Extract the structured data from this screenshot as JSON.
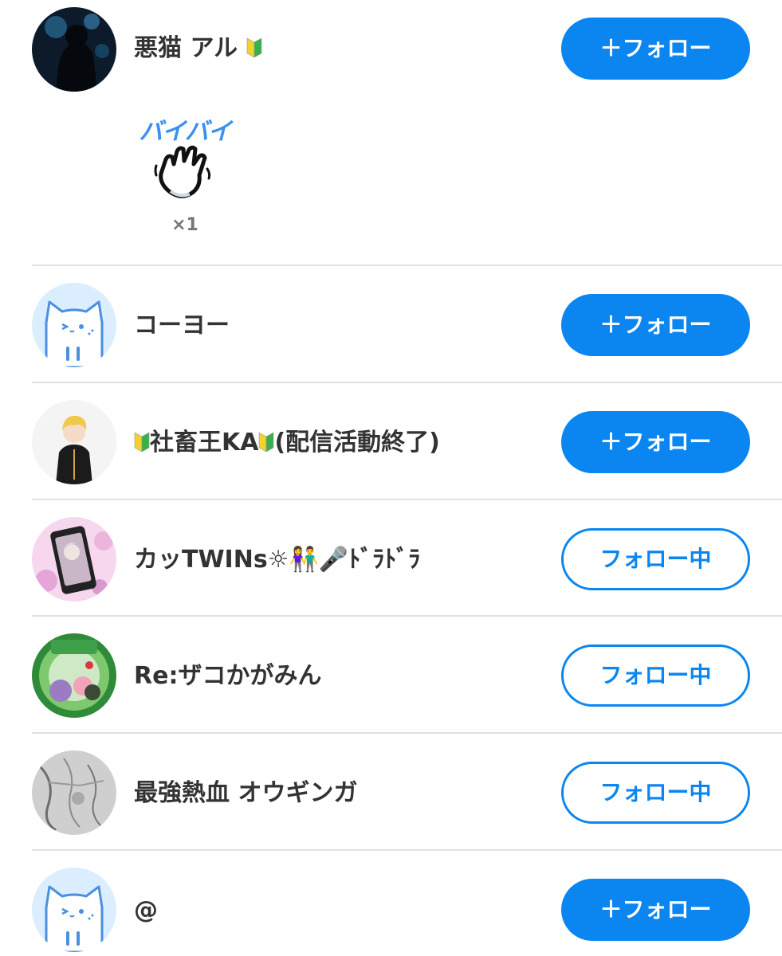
{
  "users": [
    {
      "name": "悪猫 アル",
      "badge": "beginner-mark",
      "button": "＋フォロー",
      "following": false,
      "stamp": {
        "label": "バイバイ",
        "icon": "waving-hand-icon",
        "count": "×1"
      }
    },
    {
      "name": "コーヨー",
      "button": "＋フォロー",
      "following": false
    },
    {
      "name_pre": "",
      "name_mid": "社畜王KA",
      "name_post": "(配信活動終了)",
      "button": "＋フォロー",
      "following": false
    },
    {
      "name": "カッTWINs☼👫🎤ﾄﾞﾗﾄﾞﾗ",
      "button": "フォロー中",
      "following": true
    },
    {
      "name": "Re:ザコかがみん",
      "button": "フォロー中",
      "following": true
    },
    {
      "name": "最強熱血 オウギンガ",
      "button": "フォロー中",
      "following": true
    },
    {
      "name": "@",
      "button": "＋フォロー",
      "following": false
    }
  ],
  "colors": {
    "accent": "#0b86f0",
    "text": "#333333",
    "divider": "#e1e1e1"
  }
}
